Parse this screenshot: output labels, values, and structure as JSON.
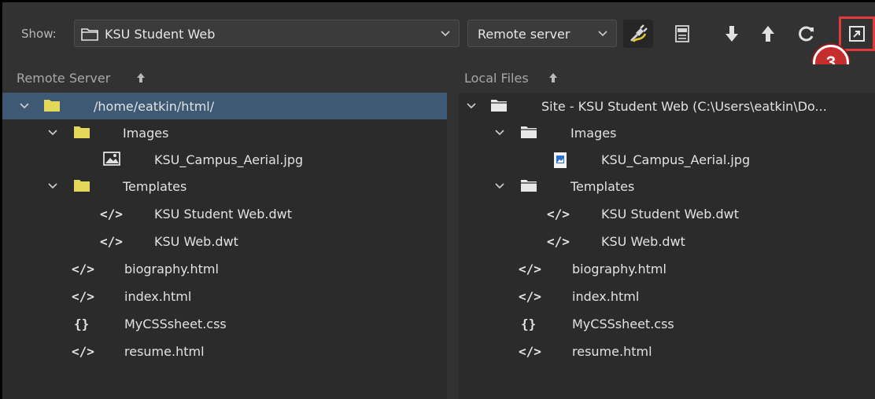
{
  "toolbar": {
    "show_label": "Show:",
    "site": "KSU Student Web",
    "server": "Remote server",
    "callout": "3",
    "buttons": [
      "connect-icon",
      "ftp-log-icon",
      "get-icon",
      "put-icon",
      "refresh-icon",
      "expand-icon"
    ],
    "highlight_color": "#e23a3a"
  },
  "remote": {
    "title": "Remote Server",
    "root": "/home/eatkin/html/",
    "images_folder": "Images",
    "image_file": "KSU_Campus_Aerial.jpg",
    "templates_folder": "Templates",
    "template1": "KSU Student Web.dwt",
    "template2": "KSU Web.dwt",
    "file1": "biography.html",
    "file2": "index.html",
    "file3": "MyCSSsheet.css",
    "file4": "resume.html"
  },
  "local": {
    "title": "Local Files",
    "root": "Site - KSU Student Web (C:\\Users\\eatkin\\Do...",
    "images_folder": "Images",
    "image_file": "KSU_Campus_Aerial.jpg",
    "templates_folder": "Templates",
    "template1": "KSU Student Web.dwt",
    "template2": "KSU Web.dwt",
    "file1": "biography.html",
    "file2": "index.html",
    "file3": "MyCSSsheet.css",
    "file4": "resume.html"
  },
  "colors": {
    "selected_row": "#3e5973",
    "remote_folder": "#e3d85a",
    "local_folder": "#e8e8e8"
  }
}
